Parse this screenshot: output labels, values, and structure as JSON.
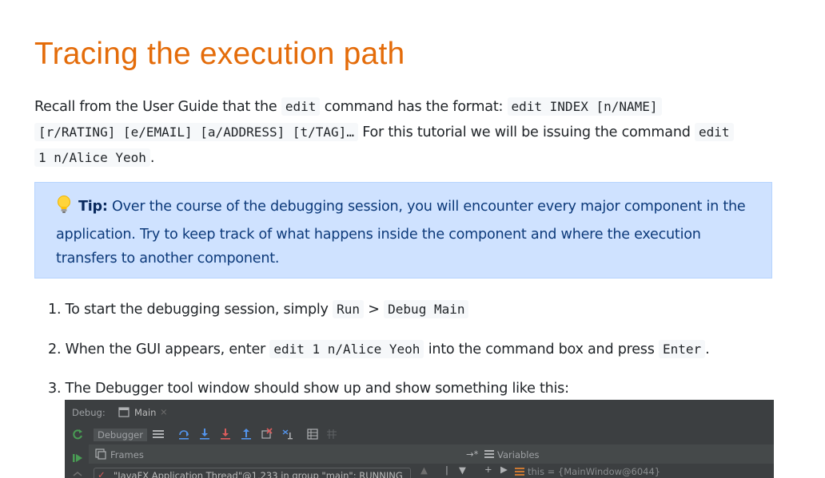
{
  "heading": "Tracing the execution path",
  "intro": {
    "t1": "Recall from the User Guide that the ",
    "c1": "edit",
    "t2": " command has the format: ",
    "c2": "edit INDEX [n/NAME]",
    "c3": "[r/RATING] [e/EMAIL] [a/ADDRESS] [t/TAG]…",
    "t3": " For this tutorial we will be issuing the command ",
    "c4": "edit",
    "c5": "1 n/Alice Yeoh",
    "t4": "."
  },
  "tip": {
    "label": "Tip:",
    "text": " Over the course of the debugging session, you will encounter every major component in the application. Try to keep track of what happens inside the component and where the execution transfers to another component."
  },
  "steps": [
    {
      "num": "1.",
      "a": " To start the debugging session, simply ",
      "c1": "Run",
      "b": " > ",
      "c2": "Debug Main",
      "d": ""
    },
    {
      "num": "2.",
      "a": " When the GUI appears, enter ",
      "c1": "edit 1 n/Alice Yeoh",
      "b": " into the command box and press ",
      "c2": "Enter",
      "d": "."
    },
    {
      "num": "3.",
      "a": " The Debugger tool window should show up and show something like this:"
    }
  ],
  "debugger": {
    "debug_label": "Debug:",
    "tab_main": "Main",
    "debugger_tab": "Debugger",
    "frames": "Frames",
    "variables": "Variables",
    "thread_text": "\"JavaFX Application Thread\"@1,233 in group \"main\": RUNNING",
    "this_var": "this = {MainWindow@6044}",
    "colors": {
      "bg": "#3c3f41",
      "accent": "#5394ec",
      "green": "#499c54",
      "orange": "#cc7832"
    }
  }
}
